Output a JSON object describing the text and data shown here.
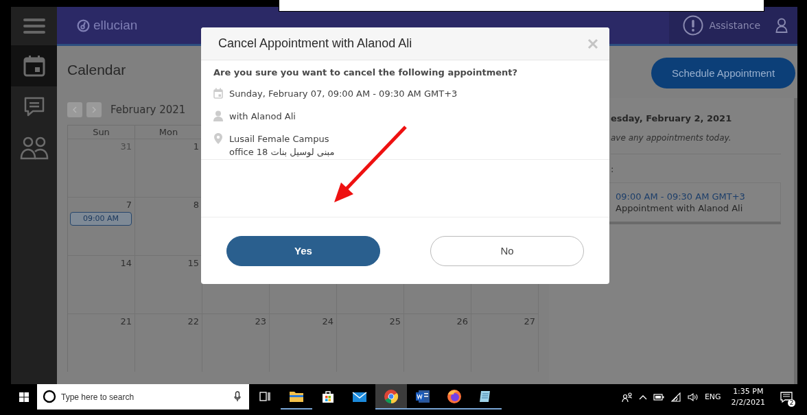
{
  "sidebar": {
    "items": [
      {
        "kind": "calendar",
        "selected": true
      },
      {
        "kind": "messages",
        "selected": false
      },
      {
        "kind": "people",
        "selected": false
      }
    ]
  },
  "header": {
    "logo": "ellucian",
    "assistance": "Assistance"
  },
  "page": {
    "title": "Calendar",
    "schedule_button": "Schedule Appointment"
  },
  "calendar": {
    "month": "February 2021",
    "weekdays": [
      "Sun",
      "Mon"
    ],
    "weeks": [
      [
        {
          "day": "31",
          "other_month": true
        },
        {
          "day": "1",
          "other_month": false
        }
      ],
      [
        {
          "day": "7",
          "other_month": false,
          "event": "09:00 AM"
        },
        {
          "day": "8",
          "other_month": false
        }
      ],
      [
        {
          "day": "14",
          "other_month": false
        },
        {
          "day": "15",
          "other_month": false
        }
      ],
      [
        {
          "day": "21",
          "other_month": false
        },
        {
          "day": "22",
          "other_month": false
        },
        {
          "day": "23",
          "other_month": false
        },
        {
          "day": "24",
          "other_month": false
        },
        {
          "day": "25",
          "other_month": false
        },
        {
          "day": "26",
          "other_month": false
        },
        {
          "day": "27",
          "other_month": false
        }
      ]
    ]
  },
  "day_panel": {
    "date": "esday, February 2, 2021",
    "note": "ave any appointments today.",
    "section_label": ":",
    "appointment": {
      "time": "09:00 AM - 09:30 AM GMT+3",
      "title": "Appointment with Alanod Ali"
    }
  },
  "dialog": {
    "title": "Cancel Appointment with Alanod Ali",
    "question": "Are you sure you want to cancel the following appointment?",
    "details": [
      {
        "kind": "date",
        "lines": [
          "Sunday, February 07, 09:00 AM - 09:30 AM GMT+3"
        ]
      },
      {
        "kind": "person",
        "lines": [
          "with Alanod Ali"
        ]
      },
      {
        "kind": "location",
        "lines": [
          "Lusail Female Campus",
          "office 18 مبنى لوسيل بنات"
        ]
      }
    ],
    "buttons": [
      {
        "label": "Yes",
        "primary": true
      },
      {
        "label": "No",
        "primary": false
      }
    ]
  },
  "taskbar": {
    "search_placeholder": "Type here to search",
    "apps": [
      {
        "kind": "files",
        "running": true,
        "selected": false
      },
      {
        "kind": "store",
        "running": false,
        "selected": false
      },
      {
        "kind": "mail",
        "running": false,
        "selected": false
      },
      {
        "kind": "chrome",
        "running": true,
        "selected": true
      },
      {
        "kind": "word",
        "running": true,
        "selected": false
      },
      {
        "kind": "firefox",
        "running": true,
        "selected": false
      },
      {
        "kind": "notepad",
        "running": true,
        "selected": false
      }
    ],
    "language": "ENG",
    "time": "1:35 PM",
    "date": "2/2/2021",
    "notifications": "2"
  }
}
